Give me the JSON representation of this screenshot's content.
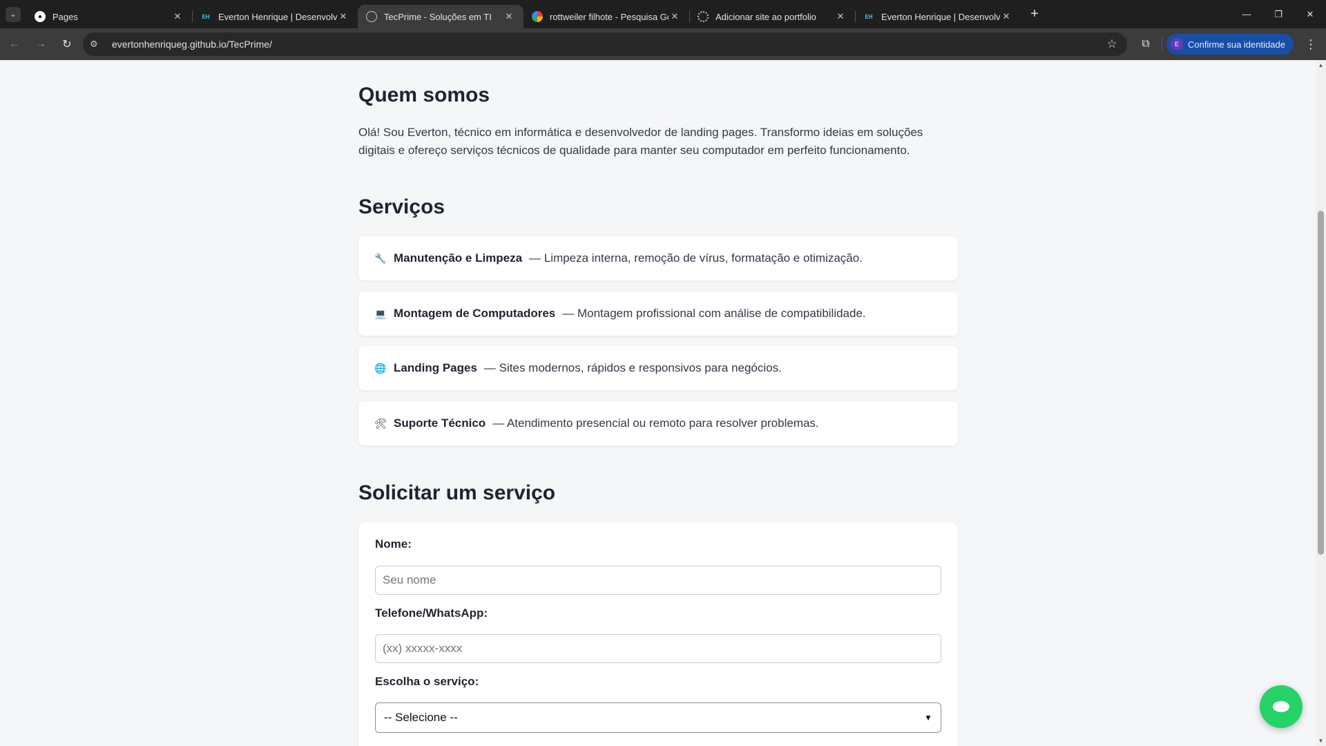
{
  "browser": {
    "tabs": [
      {
        "title": "Pages",
        "favicon": "github-icon"
      },
      {
        "title": "Everton Henrique | Desenvolvedor",
        "favicon": "eh-icon",
        "favicon_text": "EH"
      },
      {
        "title": "TecPrime - Soluções em TI",
        "favicon": "globe-icon",
        "active": true
      },
      {
        "title": "rottweiler filhote - Pesquisa Google",
        "favicon": "google-icon"
      },
      {
        "title": "Adicionar site ao portfolio",
        "favicon": "chatgpt-icon"
      },
      {
        "title": "Everton Henrique | Desenvolvedor",
        "favicon": "eh-icon",
        "favicon_text": "EH"
      }
    ],
    "url": "evertonhenriqueg.github.io/TecPrime/",
    "profile_label": "Confirme sua identidade",
    "profile_initial": "E"
  },
  "page": {
    "about": {
      "title": "Quem somos",
      "text": "Olá! Sou Everton, técnico em informática e desenvolvedor de landing pages. Transformo ideias em soluções digitais e ofereço serviços técnicos de qualidade para manter seu computador em perfeito funcionamento."
    },
    "services": {
      "title": "Serviços",
      "items": [
        {
          "icon": "wrench-icon",
          "glyph": "🔧",
          "name": "Manutenção e Limpeza",
          "desc": "— Limpeza interna, remoção de vírus, formatação e otimização."
        },
        {
          "icon": "laptop-icon",
          "glyph": "💻",
          "name": "Montagem de Computadores",
          "desc": "— Montagem profissional com análise de compatibilidade."
        },
        {
          "icon": "globe-icon",
          "glyph": "🌐",
          "name": "Landing Pages",
          "desc": "— Sites modernos, rápidos e responsivos para negócios."
        },
        {
          "icon": "tools-icon",
          "glyph": "🛠",
          "name": "Suporte Técnico",
          "desc": "— Atendimento presencial ou remoto para resolver problemas."
        }
      ]
    },
    "form": {
      "title": "Solicitar um serviço",
      "name_label": "Nome:",
      "name_placeholder": "Seu nome",
      "phone_label": "Telefone/WhatsApp:",
      "phone_placeholder": "(xx) xxxxx-xxxx",
      "service_label": "Escolha o serviço:",
      "service_selected": "-- Selecione --"
    }
  },
  "colors": {
    "page_bg": "#f5f6f8",
    "heading": "#1f2330",
    "chat_button": "#25d366",
    "profile_chip": "#174ea6"
  }
}
